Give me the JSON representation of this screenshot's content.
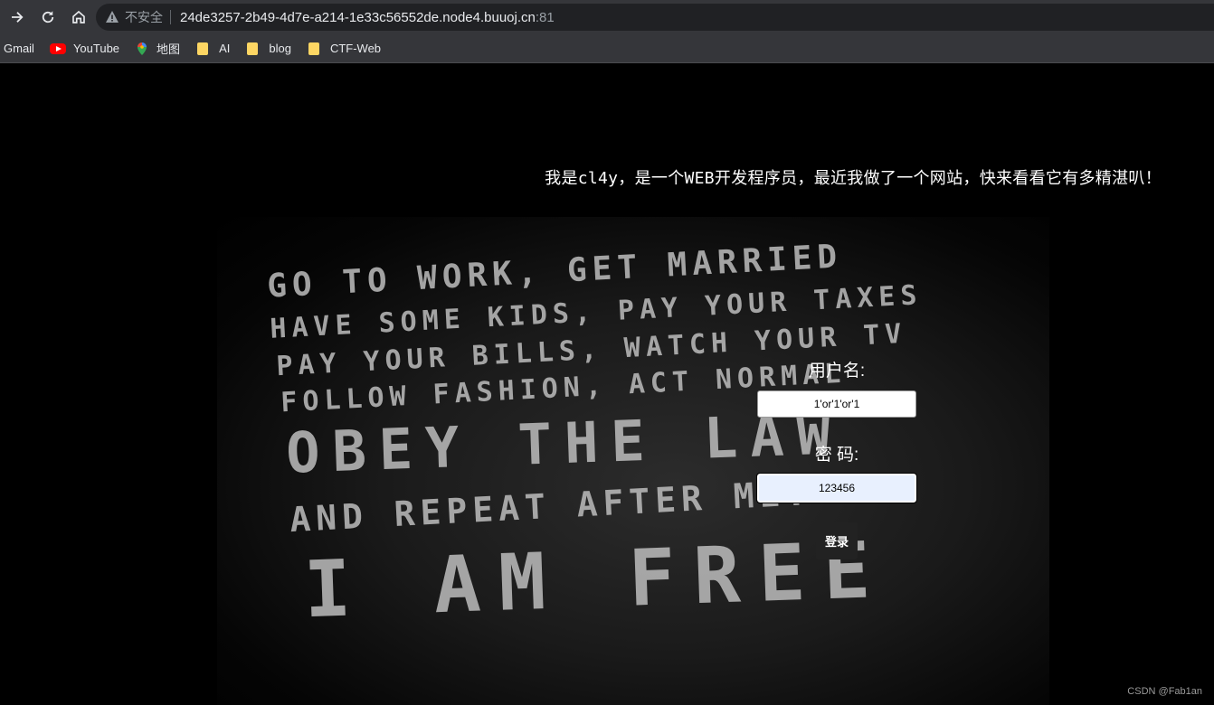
{
  "browser": {
    "security_label": "不安全",
    "url_host": "24de3257-2b49-4d7e-a214-1e33c56552de.node4.buuoj.cn",
    "url_port": ":81",
    "bookmarks": [
      {
        "label": "Gmail",
        "icon": "gmail-icon"
      },
      {
        "label": "YouTube",
        "icon": "youtube-icon"
      },
      {
        "label": "地图",
        "icon": "maps-icon"
      },
      {
        "label": "AI",
        "icon": "folder-icon"
      },
      {
        "label": "blog",
        "icon": "folder-icon"
      },
      {
        "label": "CTF-Web",
        "icon": "folder-icon"
      }
    ]
  },
  "page": {
    "headline": "我是cl4y，是一个WEB开发程序员，最近我做了一个网站，快来看看它有多精湛叭！",
    "poster_lines": [
      "GO TO WORK, GET MARRIED",
      "HAVE SOME KIDS, PAY YOUR TAXES",
      "PAY YOUR BILLS, WATCH YOUR TV",
      "FOLLOW FASHION, ACT NORMAL",
      "OBEY THE LAW",
      "AND REPEAT AFTER ME:",
      "I AM FREE"
    ],
    "login": {
      "username_label": "用户名:",
      "username_value": "1'or'1'or'1",
      "password_label": "密 码:",
      "password_value": "123456",
      "submit_label": "登录"
    },
    "watermark": "CSDN @Fab1an"
  }
}
